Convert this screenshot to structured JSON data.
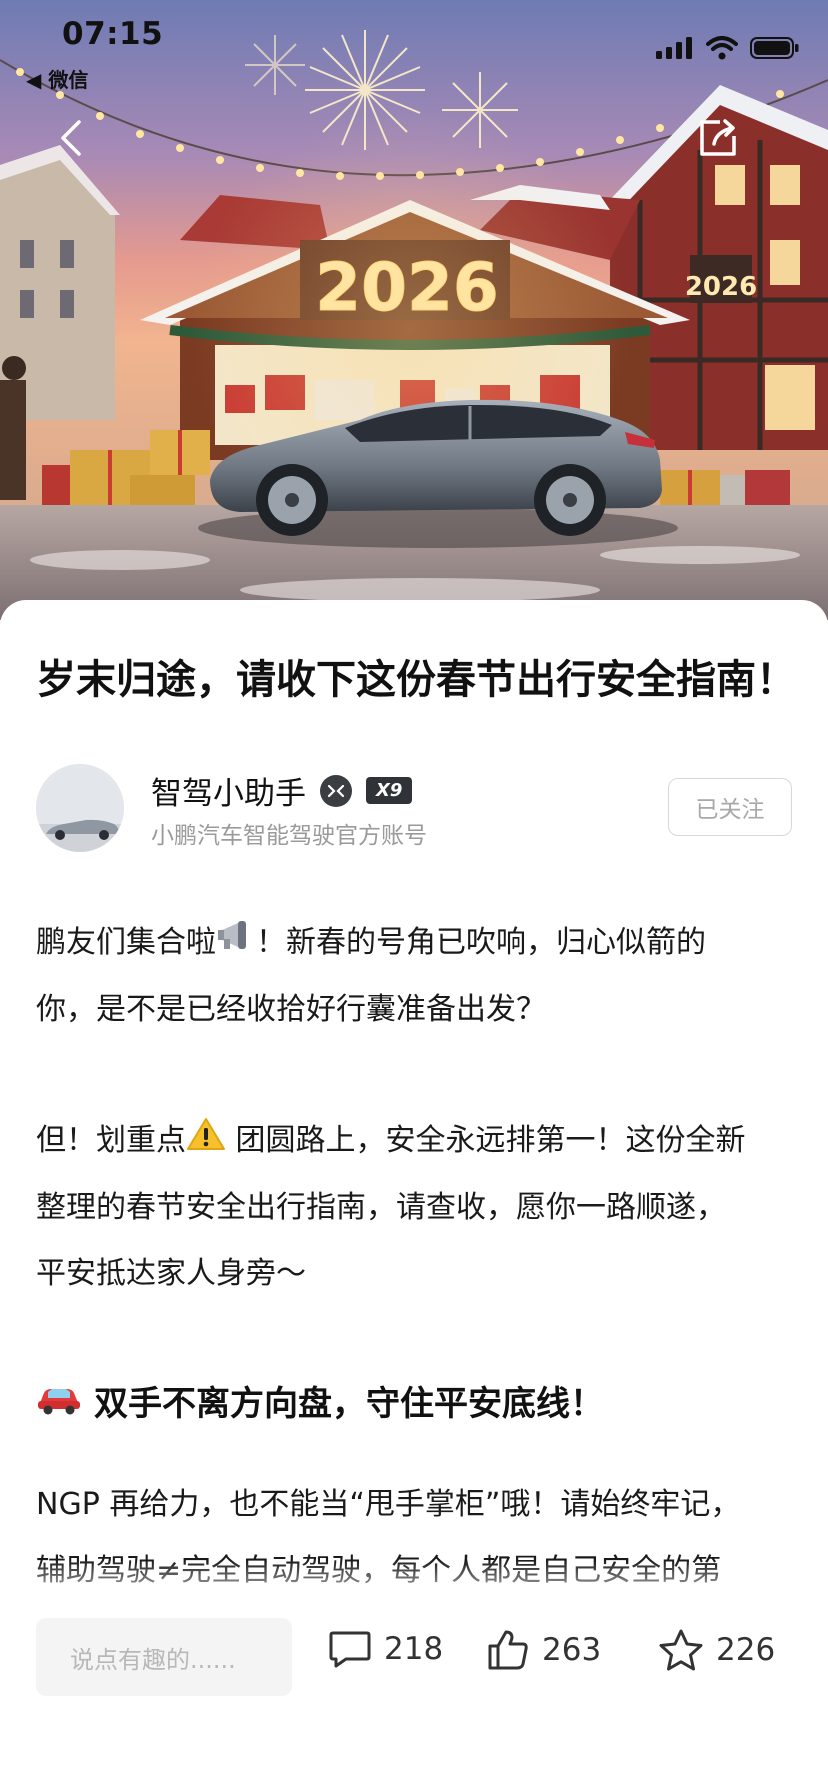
{
  "status_bar": {
    "time": "07:15",
    "back_app": "◀ 微信"
  },
  "hero": {
    "year_sign": "2026",
    "year_sign_small": "2026"
  },
  "article": {
    "title": "岁末归途，请收下这份春节出行安全指南！",
    "author": {
      "name": "智驾小助手",
      "badge": "X9",
      "description": "小鹏汽车智能驾驶官方账号",
      "follow_label": "已关注"
    },
    "paragraphs": [
      {
        "line1": "鹏友们集合啦",
        "line1_rest": "！新春的号角已吹响，归心似箭的",
        "line2": "你，是不是已经收拾好行囊准备出发？"
      },
      {
        "line1": "但！划重点",
        "line1_rest": " 团圆路上，安全永远排第一！这份全新",
        "line2": "整理的春节安全出行指南，请查收，愿你一路顺遂，",
        "line3": "平安抵达家人身旁～"
      }
    ],
    "section_heading": "双手不离方向盘，守住平安底线！",
    "section_paragraph": {
      "line1": "NGP 再给力，也不能当“甩手掌柜”哦！请始终牢记，",
      "line2": "辅助驾驶≠完全自动驾驶，每个人都是自己安全的第"
    }
  },
  "bottom_bar": {
    "comment_placeholder": "说点有趣的......",
    "comment_count": "218",
    "like_count": "263",
    "favorite_count": "226"
  },
  "icons": [
    "signal-icon",
    "wifi-icon",
    "battery-icon",
    "back-arrow-icon",
    "share-icon",
    "megaphone-icon",
    "warning-icon",
    "car-icon",
    "comment-icon",
    "like-icon",
    "star-icon",
    "verified-icon"
  ]
}
